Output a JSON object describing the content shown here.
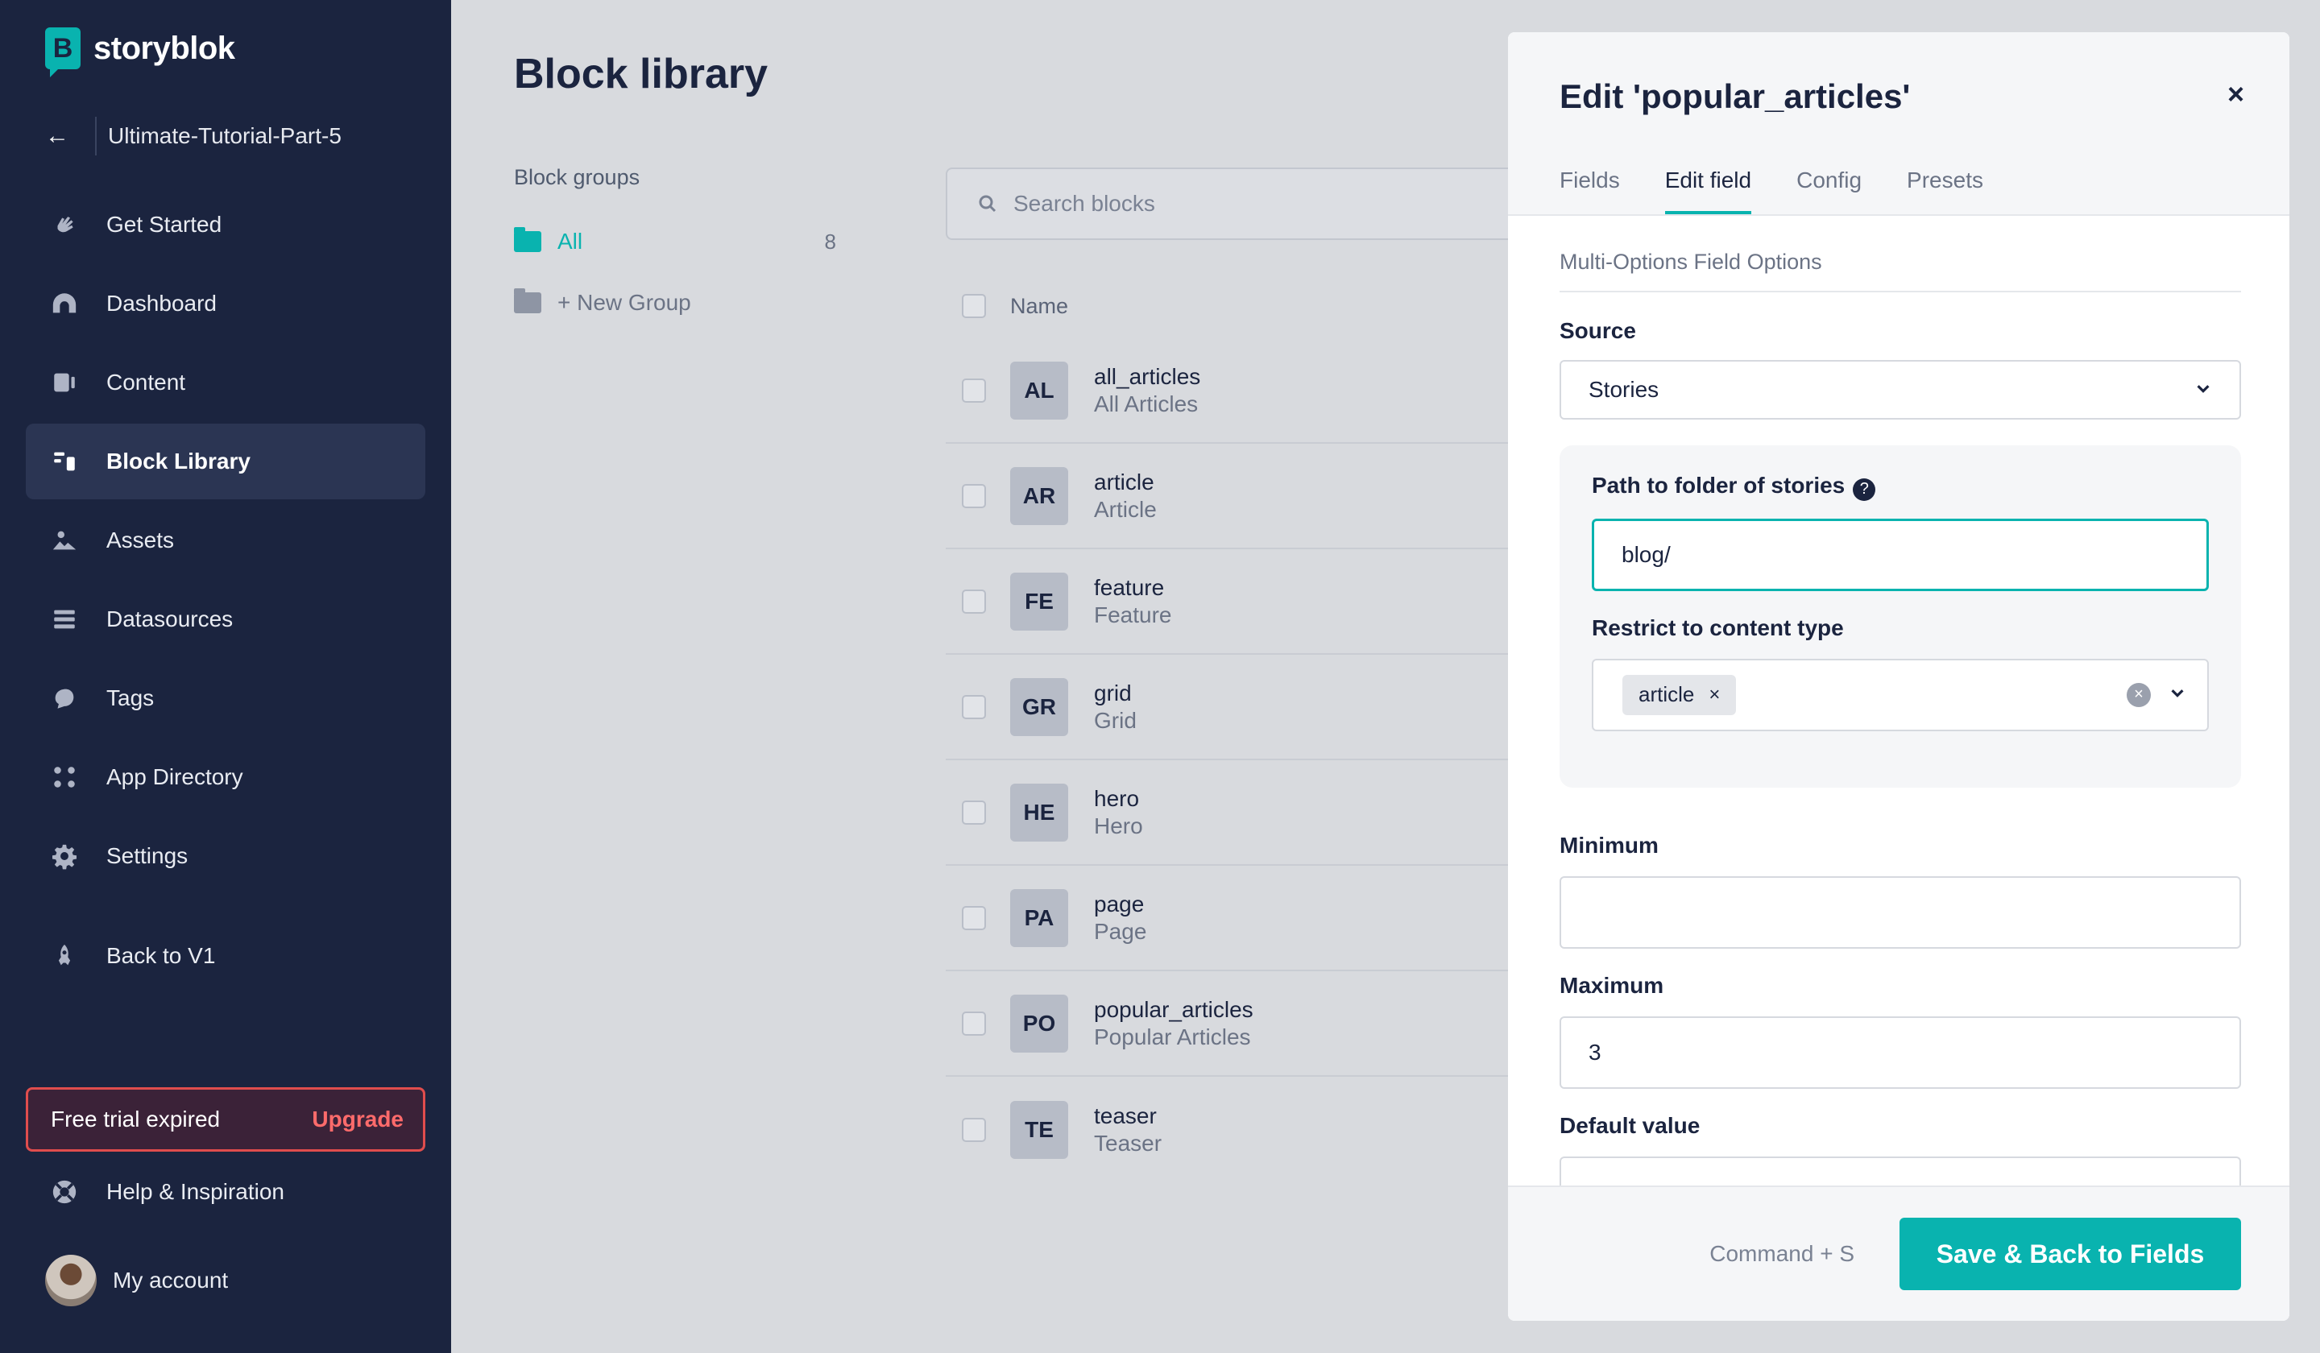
{
  "app": {
    "logo_letter": "B",
    "logo_text": "storyblok"
  },
  "space": {
    "name": "Ultimate-Tutorial-Part-5"
  },
  "sidebar": {
    "items": [
      {
        "label": "Get Started",
        "icon": "hand-wave-icon"
      },
      {
        "label": "Dashboard",
        "icon": "dashboard-icon"
      },
      {
        "label": "Content",
        "icon": "content-icon"
      },
      {
        "label": "Block Library",
        "icon": "block-library-icon",
        "active": true
      },
      {
        "label": "Assets",
        "icon": "assets-icon"
      },
      {
        "label": "Datasources",
        "icon": "datasources-icon"
      },
      {
        "label": "Tags",
        "icon": "tags-icon"
      },
      {
        "label": "App Directory",
        "icon": "app-directory-icon"
      },
      {
        "label": "Settings",
        "icon": "gear-icon"
      },
      {
        "label": "Back to V1",
        "icon": "rocket-icon"
      }
    ],
    "trial_text": "Free trial expired",
    "upgrade": "Upgrade",
    "help": "Help & Inspiration",
    "account": "My account"
  },
  "main": {
    "title": "Block library",
    "groups_title": "Block groups",
    "groups": [
      {
        "label": "All",
        "count": "8"
      },
      {
        "label": "+ New Group"
      }
    ],
    "search_placeholder": "Search blocks",
    "column_name": "Name",
    "blocks": [
      {
        "badge": "AL",
        "name": "all_articles",
        "display": "All Articles"
      },
      {
        "badge": "AR",
        "name": "article",
        "display": "Article"
      },
      {
        "badge": "FE",
        "name": "feature",
        "display": "Feature"
      },
      {
        "badge": "GR",
        "name": "grid",
        "display": "Grid"
      },
      {
        "badge": "HE",
        "name": "hero",
        "display": "Hero"
      },
      {
        "badge": "PA",
        "name": "page",
        "display": "Page"
      },
      {
        "badge": "PO",
        "name": "popular_articles",
        "display": "Popular Articles"
      },
      {
        "badge": "TE",
        "name": "teaser",
        "display": "Teaser"
      }
    ]
  },
  "panel": {
    "title": "Edit 'popular_articles'",
    "close": "×",
    "tabs": [
      "Fields",
      "Edit field",
      "Config",
      "Presets"
    ],
    "active_tab": "Edit field",
    "section_title": "Multi-Options Field Options",
    "source_label": "Source",
    "source_value": "Stories",
    "path_label": "Path to folder of stories",
    "path_value": "blog/",
    "restrict_label": "Restrict to content type",
    "restrict_chip": "article",
    "minimum_label": "Minimum",
    "minimum_value": "",
    "maximum_label": "Maximum",
    "maximum_value": "3",
    "default_label": "Default value",
    "shortcut": "Command + S",
    "save_button": "Save & Back to Fields"
  },
  "colors": {
    "accent": "#09b3af",
    "sidebar": "#1b243f",
    "danger": "#e04d4d"
  }
}
